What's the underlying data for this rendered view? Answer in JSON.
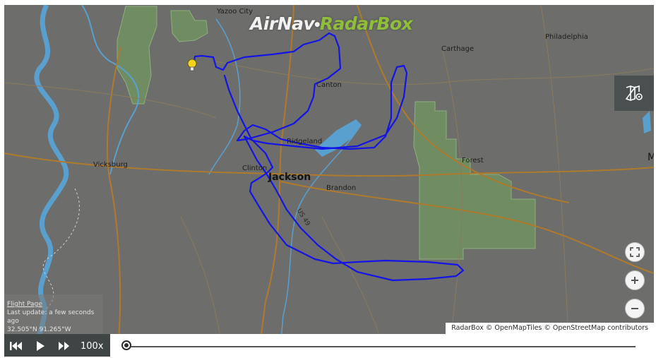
{
  "logo": {
    "part1": "AirNav",
    "part2": "RadarBox"
  },
  "cities": [
    {
      "name": "Yazoo City"
    },
    {
      "name": "Philadelphia"
    },
    {
      "name": "Carthage"
    },
    {
      "name": "Canton"
    },
    {
      "name": "Ridgeland"
    },
    {
      "name": "Forest"
    },
    {
      "name": "Vicksburg"
    },
    {
      "name": "Clinton"
    },
    {
      "name": "Jackson"
    },
    {
      "name": "Brandon"
    },
    {
      "name": "M"
    }
  ],
  "road_label": "US 49",
  "info_panel": {
    "link_text": "Flight Page",
    "last_update": "Last update: a few seconds ago",
    "coords": "32.505°N 91.265°W"
  },
  "attribution": "RadarBox © OpenMapTiles © OpenStreetMap contributors",
  "playback": {
    "speed": "100x",
    "progress": 0
  },
  "colors": {
    "track": "#1414e6",
    "forest": "#6f8c62",
    "water": "#5aa0cf",
    "logo_green": "#8fbf3a"
  },
  "icons": {
    "layers": "map-settings-icon",
    "fullscreen": "fullscreen-icon",
    "zoom_in": "plus-icon",
    "zoom_out": "minus-icon",
    "skip_back": "skip-back-icon",
    "play": "play-icon",
    "fast_forward": "fast-forward-icon",
    "marker": "lightbulb-marker-icon"
  }
}
